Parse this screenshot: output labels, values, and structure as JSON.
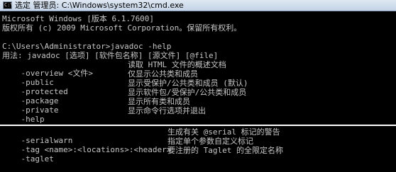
{
  "window": {
    "title": "选定 管理员: C:\\Windows\\system32\\cmd.exe",
    "icon": "cmd-icon"
  },
  "console": {
    "header_lines": [
      "Microsoft Windows [版本 6.1.7600]",
      "版权所有 (c) 2009 Microsoft Corporation。保留所有权利。",
      "",
      "C:\\Users\\Administrator>javadoc -help",
      "用法: javadoc [选项] [软件包名称] [源文件] [@file]"
    ],
    "options": [
      {
        "flag": "-overview <文件>",
        "desc": "读取 HTML 文件的概述文档"
      },
      {
        "flag": "-public",
        "desc": "仅显示公共类和成员"
      },
      {
        "flag": "-protected",
        "desc": "显示受保护/公共类和成员 (默认)"
      },
      {
        "flag": "-package",
        "desc": "显示软件包/受保护/公共类和成员"
      },
      {
        "flag": "-private",
        "desc": "显示所有类和成员"
      },
      {
        "flag": "-help",
        "desc": "显示命令行选项并退出"
      }
    ],
    "options_lower": [
      {
        "flag": "-serialwarn",
        "desc": "生成有关 @serial 标记的警告"
      },
      {
        "flag": "-tag <name>:<locations>:<header>",
        "desc": "指定单个参数自定义标记"
      },
      {
        "flag": "-taglet",
        "desc": "要注册的 Taglet 的全限定名称"
      }
    ]
  }
}
